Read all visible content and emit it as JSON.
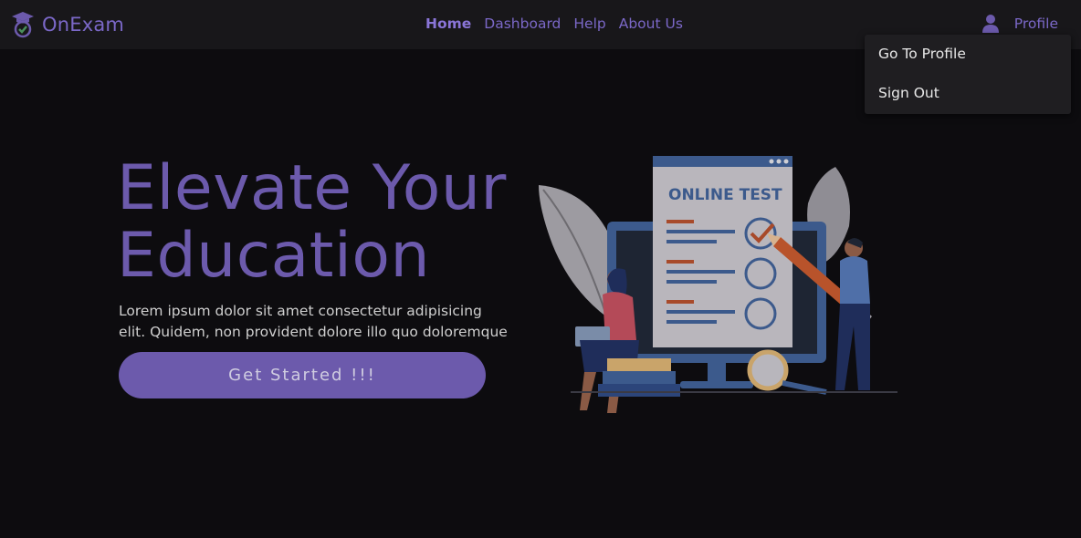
{
  "brand": {
    "name": "OnExam",
    "logo_icon": "graduation-cap-check-icon",
    "color": "#7b68c8"
  },
  "nav": {
    "links": [
      {
        "label": "Home",
        "active": true
      },
      {
        "label": "Dashboard",
        "active": false
      },
      {
        "label": "Help",
        "active": false
      },
      {
        "label": "About Us",
        "active": false
      }
    ]
  },
  "profile": {
    "label": "Profile",
    "icon": "user-icon"
  },
  "dropdown": {
    "items": [
      "Go To Profile",
      "Sign Out"
    ]
  },
  "hero": {
    "title": "Elevate Your Education",
    "text": "Lorem ipsum dolor sit amet consectetur adipisicing elit. Quidem, non provident dolore illo quo doloremque",
    "cta_label": "Get Started !!!",
    "accent": "#6c5aac"
  },
  "illustration": {
    "screen_title": "ONLINE TEST",
    "description_icons": [
      "monitor-icon",
      "checklist-icon",
      "pencil-icon",
      "magnifier-icon",
      "books-icon",
      "plant-leaf-icon"
    ]
  }
}
